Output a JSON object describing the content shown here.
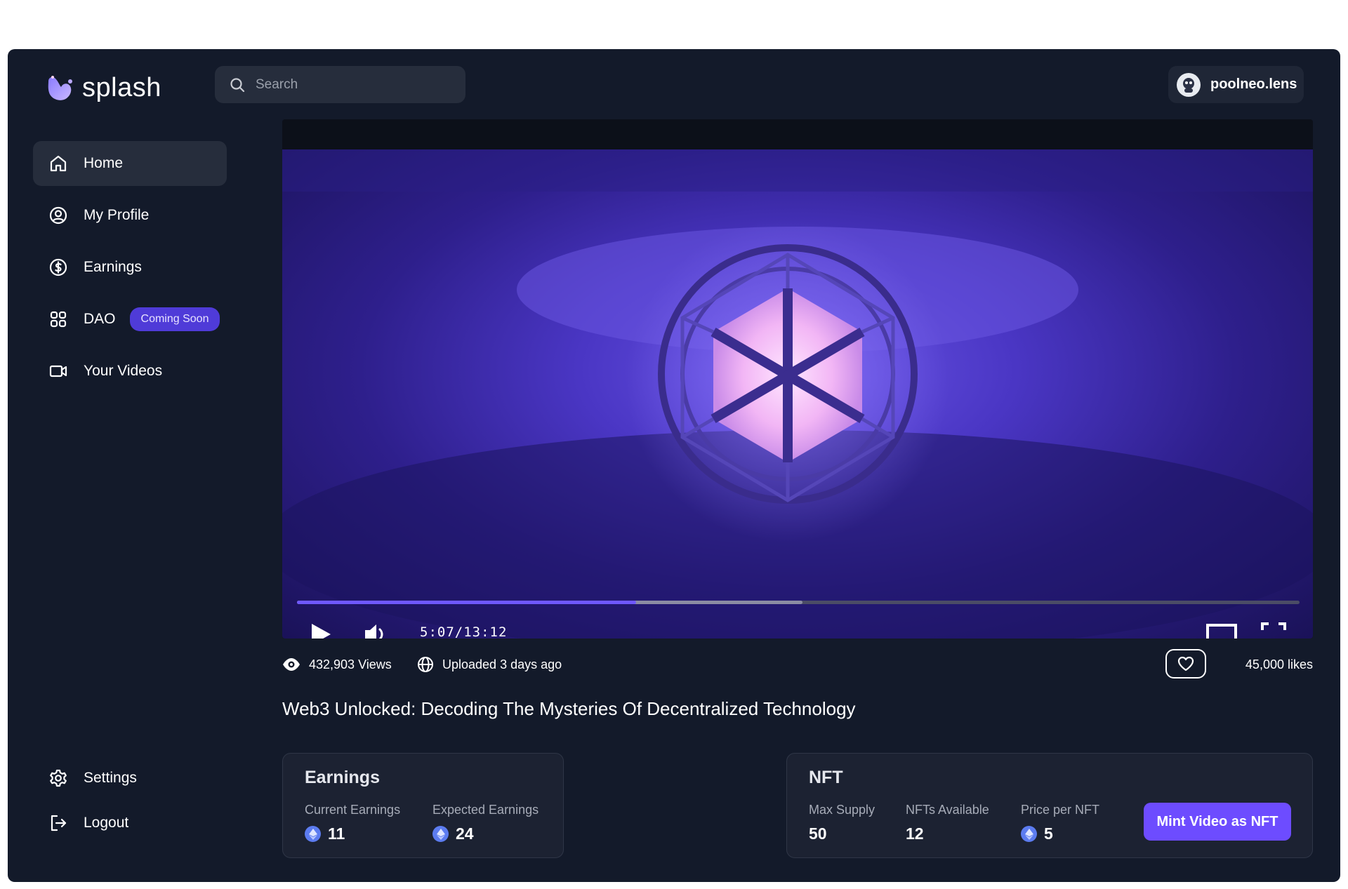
{
  "app": {
    "name": "splash"
  },
  "search": {
    "placeholder": "Search"
  },
  "user": {
    "name": "poolneo.lens"
  },
  "sidebar": {
    "items": [
      {
        "label": "Home",
        "icon": "home-icon",
        "active": true
      },
      {
        "label": "My Profile",
        "icon": "user-circle-icon"
      },
      {
        "label": "Earnings",
        "icon": "dollar-circle-icon"
      },
      {
        "label": "DAO",
        "icon": "grid-icon",
        "badge": "Coming Soon"
      },
      {
        "label": "Your Videos",
        "icon": "video-camera-icon"
      }
    ],
    "bottom": [
      {
        "label": "Settings",
        "icon": "gear-icon"
      },
      {
        "label": "Logout",
        "icon": "logout-icon"
      }
    ]
  },
  "player": {
    "time": "5:07/13:12",
    "progress": 0.338,
    "buffered": 0.504
  },
  "video": {
    "views": "432,903 Views",
    "uploaded": "Uploaded 3 days ago",
    "likes": "45,000 likes",
    "title": "Web3 Unlocked: Decoding The Mysteries Of Decentralized Technology"
  },
  "earnings": {
    "title": "Earnings",
    "current_label": "Current Earnings",
    "current_value": "11",
    "expected_label": "Expected Earnings",
    "expected_value": "24"
  },
  "nft": {
    "title": "NFT",
    "max_supply_label": "Max Supply",
    "max_supply_value": "50",
    "available_label": "NFTs Available",
    "available_value": "12",
    "price_label": "Price per NFT",
    "price_value": "5",
    "mint_label": "Mint Video as NFT"
  },
  "colors": {
    "background": "#131a2a",
    "accent": "#6d4cff",
    "badge": "#4f3bd8",
    "eth": "#5c7cf0"
  }
}
